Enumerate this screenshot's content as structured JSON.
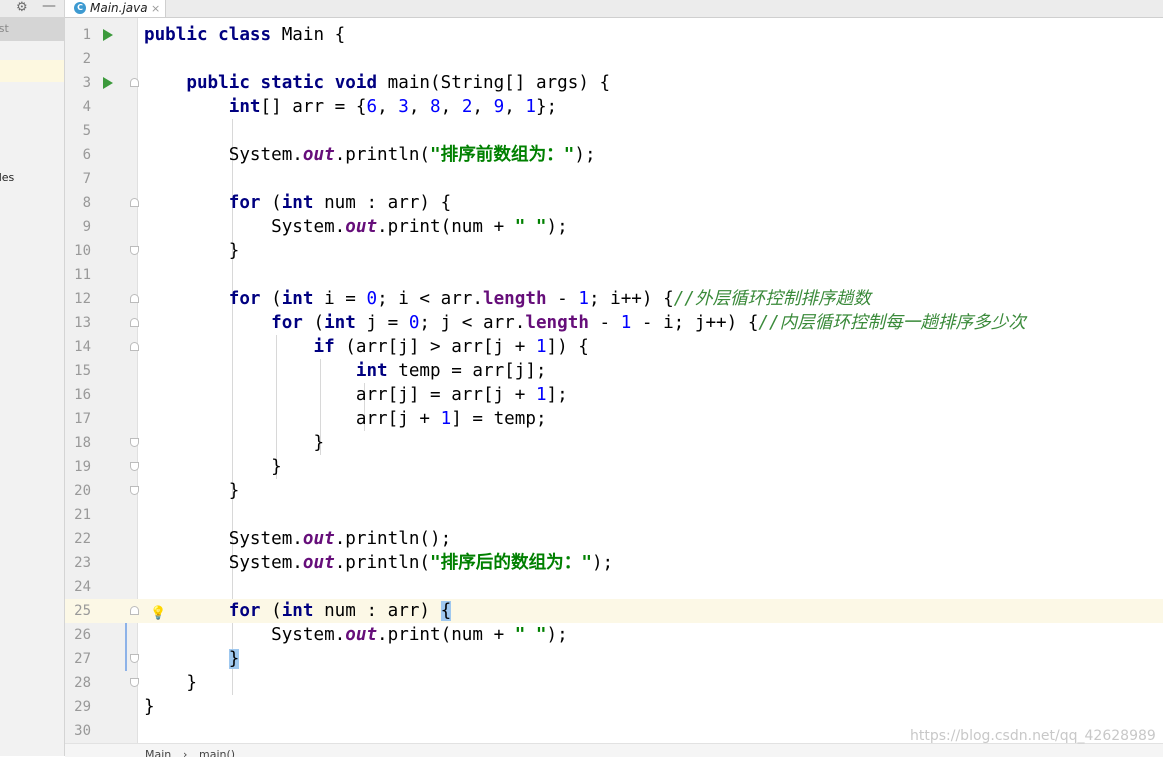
{
  "project_panel": {
    "selected_fragment": "est",
    "item_fragment": "oles"
  },
  "tab": {
    "label": "Main.java",
    "icon": "java-class-icon",
    "close": "×"
  },
  "breadcrumb": {
    "class": "Main",
    "separator": "›",
    "method": "main()"
  },
  "watermark": "https://blog.csdn.net/qq_42628989",
  "editor": {
    "current_line": 25,
    "lines": [
      {
        "n": "1"
      },
      {
        "n": "2"
      },
      {
        "n": "3"
      },
      {
        "n": "4"
      },
      {
        "n": "5"
      },
      {
        "n": "6"
      },
      {
        "n": "7"
      },
      {
        "n": "8"
      },
      {
        "n": "9"
      },
      {
        "n": "10"
      },
      {
        "n": "11"
      },
      {
        "n": "12"
      },
      {
        "n": "13"
      },
      {
        "n": "14"
      },
      {
        "n": "15"
      },
      {
        "n": "16"
      },
      {
        "n": "17"
      },
      {
        "n": "18"
      },
      {
        "n": "19"
      },
      {
        "n": "20"
      },
      {
        "n": "21"
      },
      {
        "n": "22"
      },
      {
        "n": "23"
      },
      {
        "n": "24"
      },
      {
        "n": "25"
      },
      {
        "n": "26"
      },
      {
        "n": "27"
      },
      {
        "n": "28"
      },
      {
        "n": "29"
      },
      {
        "n": "30"
      }
    ],
    "tokens": {
      "public": "public",
      "class": "class",
      "main_cls": " Main {",
      "static": "static",
      "void": "void",
      "main_sig": " main(String[] args) {",
      "int": "int",
      "arr_decl": "[] arr = {",
      "n6": "6",
      "n3": "3",
      "n8": "8",
      "n2": "2",
      "n9": "9",
      "n1": "1",
      "n0": "0",
      "comma": ", ",
      "close_arr": "};",
      "system": "System.",
      "out": "out",
      "println_open": ".println(",
      "str_before": "\"排序前数组为：\"",
      "str_after": "\"排序后的数组为：\"",
      "str_space": "\" \"",
      "close_stmt": ");",
      "println_empty": ".println();",
      "for": "for",
      "for_each": " num : arr) {",
      "paren_open": " (",
      "print_open": ".print(num + ",
      "rbrace": "}",
      "i_init": " i = ",
      "i_cond": "; i < arr.",
      "length": "length",
      "minus": " - ",
      "i_inc": "; i++) {",
      "cmt_outer": "//外层循环控制排序趟数",
      "j_init": " j = ",
      "j_cond": "; j < arr.",
      "minus_i": " - i; j++) {",
      "cmt_inner": "//内层循环控制每一趟排序多少次",
      "if": "if",
      "if_cond": " (arr[j] > arr[j + ",
      "if_close": "]) {",
      "temp_decl": " temp = arr[j];",
      "swap1": "arr[j] = arr[j + ",
      "swap1_end": "];",
      "swap2": "arr[j + ",
      "swap2_end": "] = temp;",
      "for_each_nobrace": " num : arr) ",
      "lbrace": "{"
    }
  }
}
